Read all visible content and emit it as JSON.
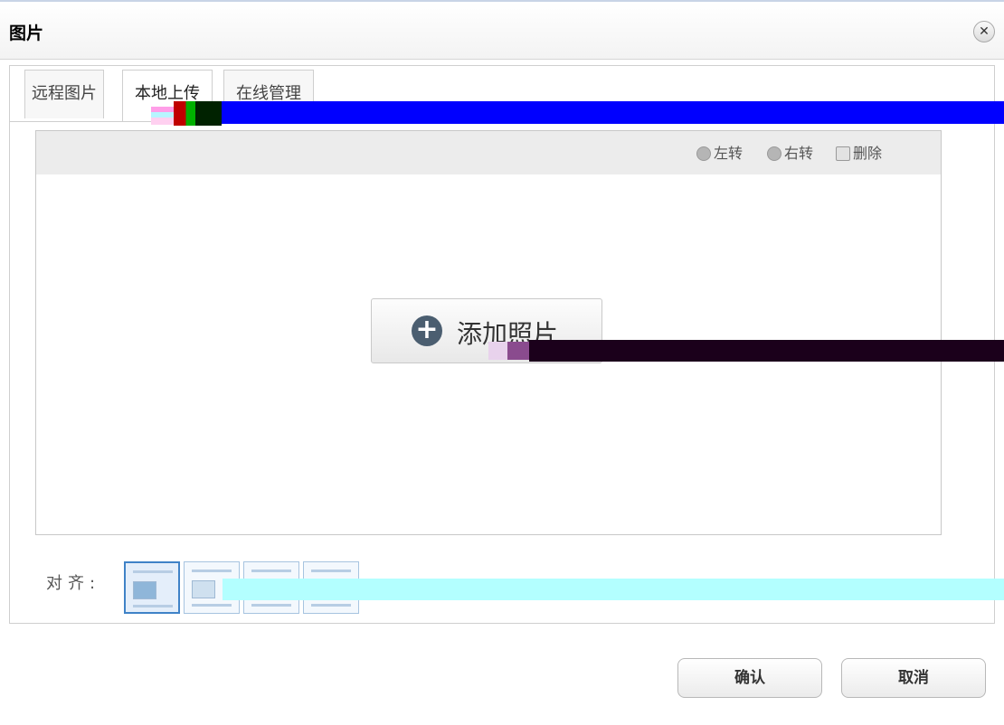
{
  "dialog": {
    "title": "图片",
    "close_symbol": "✕"
  },
  "tabs": [
    {
      "label": "远程图片",
      "active": false
    },
    {
      "label": "本地上传",
      "active": true
    },
    {
      "label": "在线管理",
      "active": false
    }
  ],
  "toolbar": {
    "rotate_left": {
      "label": "左转",
      "icon": "rotate-left-icon"
    },
    "rotate_right": {
      "label": "右转",
      "icon": "rotate-right-icon"
    },
    "delete": {
      "label": "删除",
      "icon": "delete-icon"
    }
  },
  "upload": {
    "add_label": "添加照片",
    "plus_symbol": "+"
  },
  "align": {
    "label": "对齐:",
    "options": [
      "none",
      "left",
      "right",
      "center"
    ],
    "selected": "none"
  },
  "footer": {
    "confirm_label": "确认",
    "cancel_label": "取消"
  },
  "colors": {
    "active_border": "#3f82c7",
    "plus_circle": "#4b5e70"
  }
}
